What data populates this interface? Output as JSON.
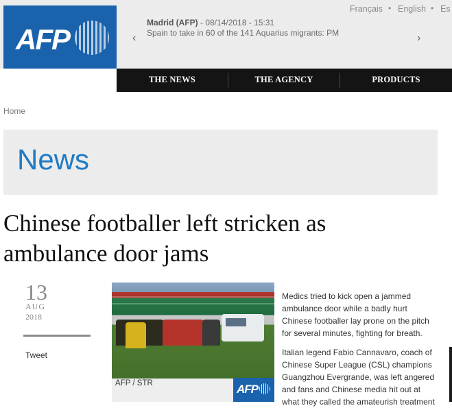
{
  "header": {
    "logo_text": "AFP",
    "languages": [
      "Français",
      "English",
      "Es"
    ],
    "ticker": {
      "source": "Madrid (AFP)",
      "date": " - 08/14/2018 - 15:31",
      "headline": "Spain to take in 60 of the 141 Aquarius migrants: PM",
      "prev_icon": "chevron-left",
      "next_icon": "chevron-right"
    }
  },
  "nav": {
    "items": [
      {
        "label": "THE NEWS"
      },
      {
        "label": "THE AGENCY"
      },
      {
        "label": "PRODUCTS"
      }
    ]
  },
  "breadcrumb": {
    "home": "Home"
  },
  "section": {
    "title": "News"
  },
  "article": {
    "headline": "Chinese footballer left stricken as ambulance door jams",
    "date": {
      "day": "13",
      "month": "AUG",
      "year": "2018"
    },
    "tweet_label": "Tweet",
    "photo_caption": "AFP / STR",
    "badge_text": "AFP",
    "paragraphs": [
      "Medics tried to kick open a jammed ambulance door while a badly hurt Chinese footballer lay prone on the pitch for several minutes, fighting for breath.",
      "Italian legend Fabio Cannavaro, coach of Chinese Super League (CSL) champions Guangzhou Evergrande, was left angered and fans and Chinese media hit out at what they called the amateurish treatment"
    ]
  },
  "colors": {
    "brand_blue": "#1a63ac",
    "section_title": "#1f7ac4",
    "nav_bg": "#141414"
  }
}
